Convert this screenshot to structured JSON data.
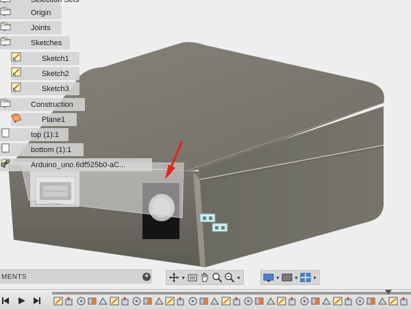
{
  "browser": {
    "items": [
      {
        "label": "Selection Sets",
        "icon": "folder-icon",
        "bulb": true
      },
      {
        "label": "Origin",
        "icon": "folder-icon",
        "bulb": true
      },
      {
        "label": "Joints",
        "icon": "folder-icon",
        "bulb": true
      },
      {
        "label": "Sketches",
        "icon": "folder-icon",
        "bulb": true
      },
      {
        "label": "Sketch1",
        "icon": "sketch-icon",
        "bulb": true
      },
      {
        "label": "Sketch2",
        "icon": "sketch-icon",
        "bulb": true
      },
      {
        "label": "Sketch3",
        "icon": "sketch-icon",
        "bulb": true
      },
      {
        "label": "Construction",
        "icon": "folder-icon",
        "bulb": true
      },
      {
        "label": "Plane1",
        "icon": "plane-icon",
        "bulb": true
      },
      {
        "label": "top (1):1",
        "icon": "component-icon",
        "bulb": true
      },
      {
        "label": "bottom (1):1",
        "icon": "component-icon",
        "bulb": true
      },
      {
        "label": "Arduino_uno.6df525b0-aC...",
        "icon": "link-icon",
        "bulb": true
      }
    ]
  },
  "comments": {
    "label": "MENTS",
    "add_icon": "plus-icon"
  },
  "viewport_toolbar": {
    "groups": [
      [
        "orbit-icon",
        "look-at-icon",
        "pan-icon",
        "zoom-icon",
        "zoom-fit-icon"
      ],
      [
        "display-settings-icon",
        "visual-style-icon",
        "grid-icon"
      ]
    ]
  },
  "timeline": {
    "playback": [
      "step-back-icon",
      "play-icon",
      "step-end-icon"
    ],
    "feature_count": 32
  },
  "colors": {
    "background": "#eeeeef",
    "model_top": "#7b7970",
    "model_side": "#6b6a61",
    "arrow": "#e8231a",
    "tree_row": "#d4d4d4"
  }
}
